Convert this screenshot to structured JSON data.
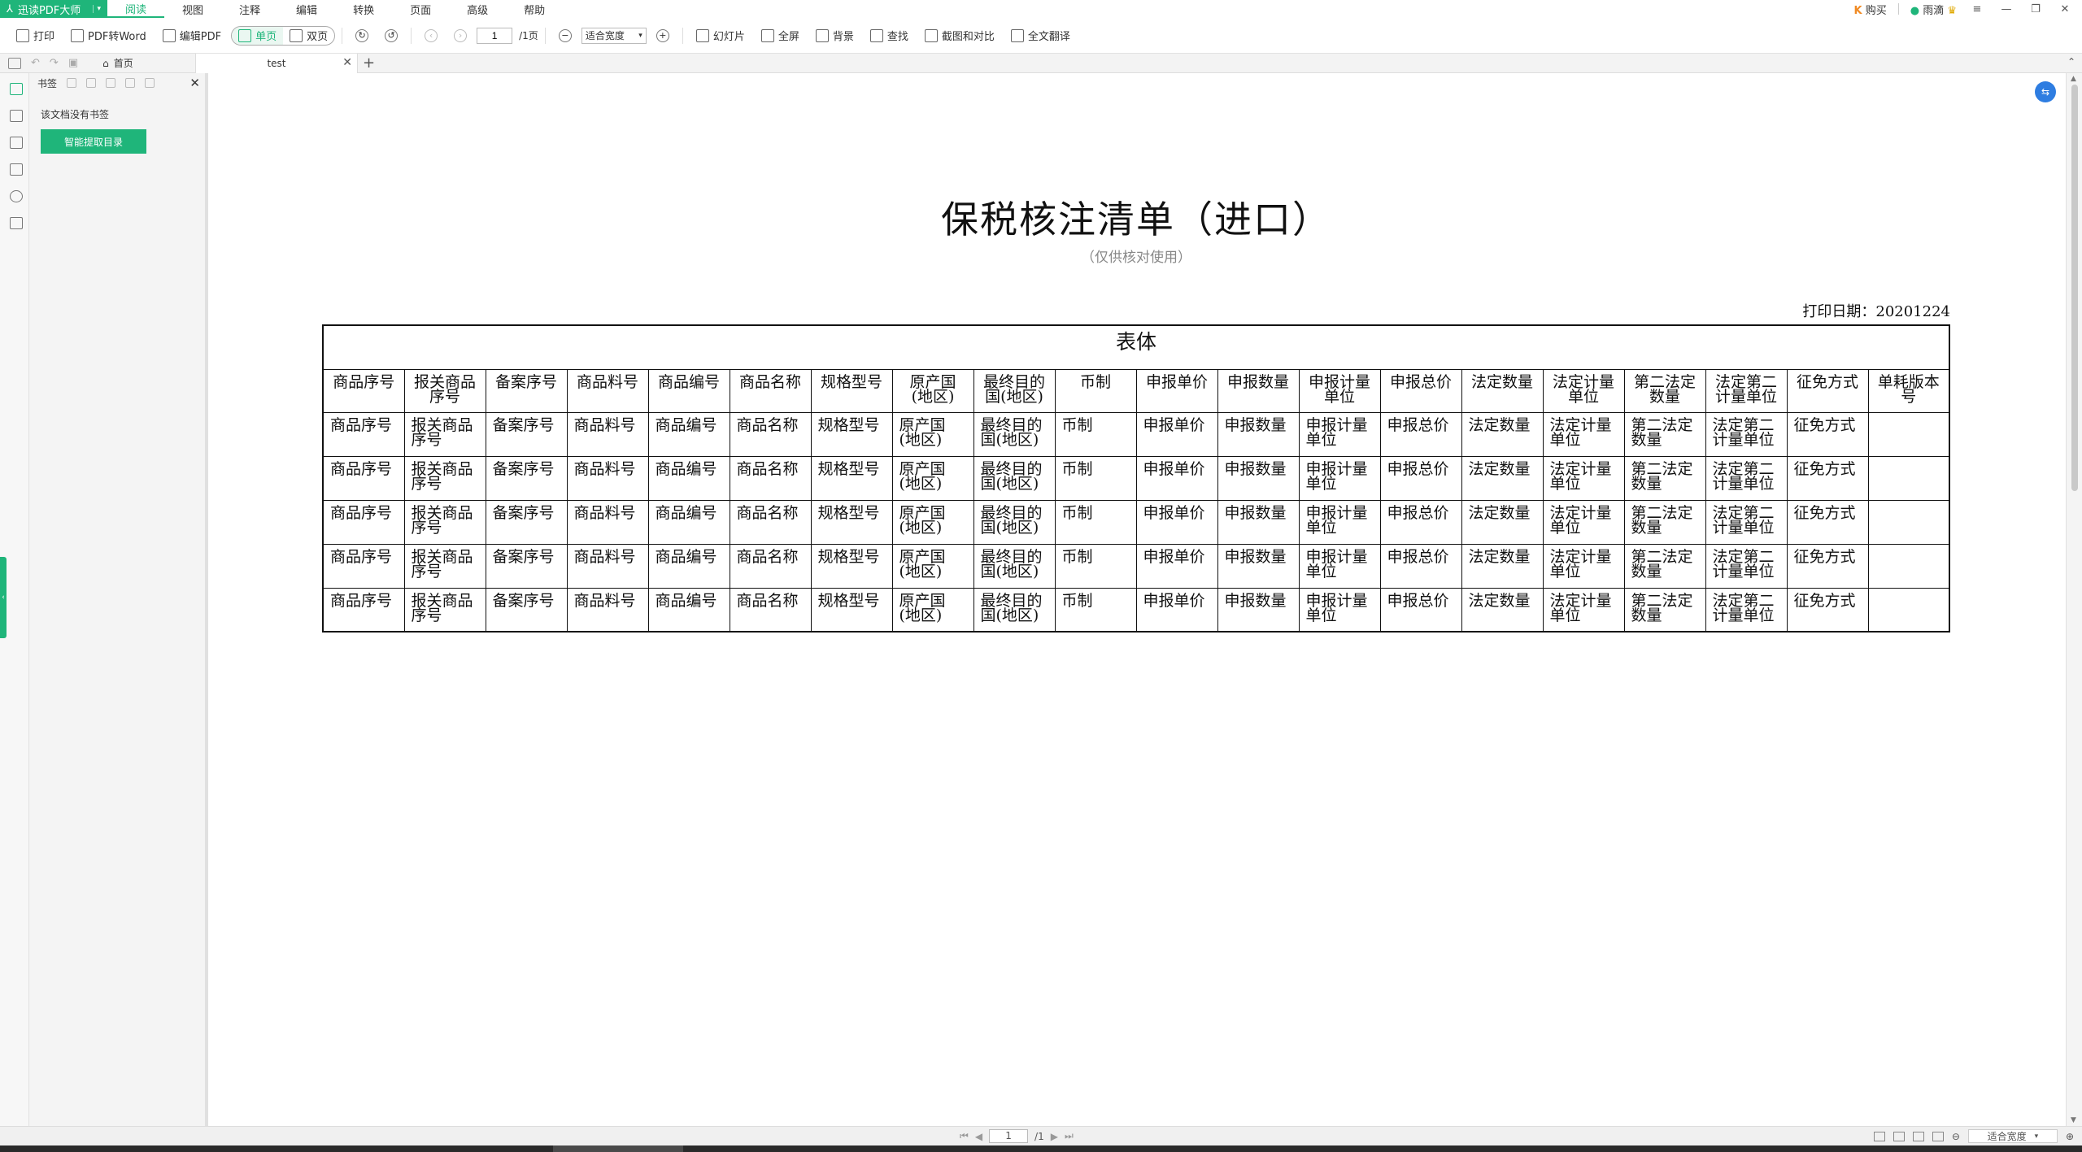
{
  "menubar": {
    "app_name": "迅读PDF大师",
    "items": [
      "阅读",
      "视图",
      "注释",
      "编辑",
      "转换",
      "页面",
      "高级",
      "帮助"
    ],
    "active_index": 0,
    "buy": "购买",
    "user": "雨滴"
  },
  "toolbar": {
    "print": "打印",
    "pdf_to_word": "PDF转Word",
    "edit_pdf": "编辑PDF",
    "single_page": "单页",
    "double_page": "双页",
    "page_current": "1",
    "page_total": "/1页",
    "zoom": "适合宽度",
    "slideshow": "幻灯片",
    "fullscreen": "全屏",
    "background": "背景",
    "find": "查找",
    "compare": "截图和对比",
    "translate": "全文翻译"
  },
  "tabs": {
    "home": "首页",
    "doc": "test"
  },
  "panel": {
    "title": "书签",
    "empty": "该文档没有书签",
    "extract_button": "智能提取目录"
  },
  "document": {
    "title": "保税核注清单（进口）",
    "subtitle": "（仅供核对使用）",
    "print_date": "打印日期：20201224",
    "table_caption": "表体",
    "headers": [
      "商品序号",
      "报关商品序号",
      "备案序号",
      "商品料号",
      "商品编号",
      "商品名称",
      "规格型号",
      "原产国(地区)",
      "最终目的国(地区)",
      "币制",
      "申报单价",
      "申报数量",
      "申报计量单位",
      "申报总价",
      "法定数量",
      "法定计量单位",
      "第二法定数量",
      "法定第二计量单位",
      "征免方式",
      "单耗版本号"
    ],
    "rows": [
      [
        "商品序号",
        "报关商品序号",
        "备案序号",
        "商品料号",
        "商品编号",
        "商品名称",
        "规格型号",
        "原产国(地区)",
        "最终目的国(地区)",
        "币制",
        "申报单价",
        "申报数量",
        "申报计量单位",
        "申报总价",
        "法定数量",
        "法定计量单位",
        "第二法定数量",
        "法定第二计量单位",
        "征免方式",
        ""
      ],
      [
        "商品序号",
        "报关商品序号",
        "备案序号",
        "商品料号",
        "商品编号",
        "商品名称",
        "规格型号",
        "原产国(地区)",
        "最终目的国(地区)",
        "币制",
        "申报单价",
        "申报数量",
        "申报计量单位",
        "申报总价",
        "法定数量",
        "法定计量单位",
        "第二法定数量",
        "法定第二计量单位",
        "征免方式",
        ""
      ],
      [
        "商品序号",
        "报关商品序号",
        "备案序号",
        "商品料号",
        "商品编号",
        "商品名称",
        "规格型号",
        "原产国(地区)",
        "最终目的国(地区)",
        "币制",
        "申报单价",
        "申报数量",
        "申报计量单位",
        "申报总价",
        "法定数量",
        "法定计量单位",
        "第二法定数量",
        "法定第二计量单位",
        "征免方式",
        ""
      ],
      [
        "商品序号",
        "报关商品序号",
        "备案序号",
        "商品料号",
        "商品编号",
        "商品名称",
        "规格型号",
        "原产国(地区)",
        "最终目的国(地区)",
        "币制",
        "申报单价",
        "申报数量",
        "申报计量单位",
        "申报总价",
        "法定数量",
        "法定计量单位",
        "第二法定数量",
        "法定第二计量单位",
        "征免方式",
        ""
      ],
      [
        "商品序号",
        "报关商品序号",
        "备案序号",
        "商品料号",
        "商品编号",
        "商品名称",
        "规格型号",
        "原产国(地区)",
        "最终目的国(地区)",
        "币制",
        "申报单价",
        "申报数量",
        "申报计量单位",
        "申报总价",
        "法定数量",
        "法定计量单位",
        "第二法定数量",
        "法定第二计量单位",
        "征免方式",
        ""
      ]
    ]
  },
  "statusbar": {
    "page_current": "1",
    "page_total": "/1",
    "zoom": "适合宽度"
  },
  "colors": {
    "accent": "#1fb57a",
    "float_button": "#2e7de1"
  }
}
